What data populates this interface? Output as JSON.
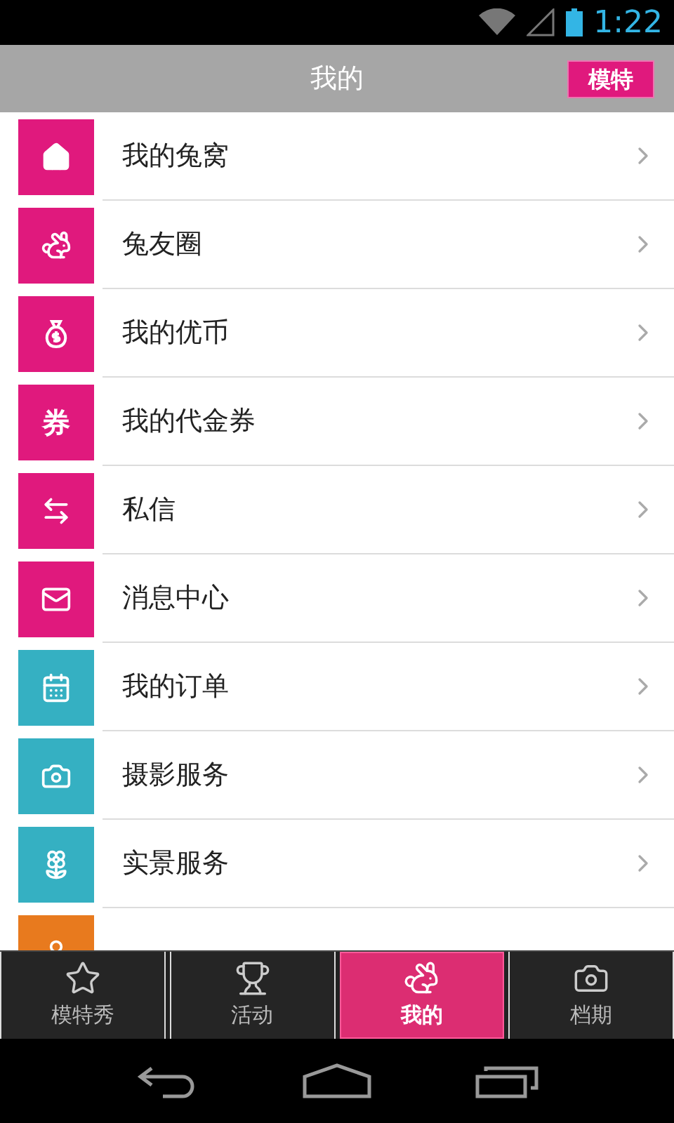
{
  "status_bar": {
    "time": "1:22"
  },
  "header": {
    "title": "我的",
    "badge": "模特"
  },
  "menu": [
    {
      "label": "我的兔窝",
      "color": "#e0197d"
    },
    {
      "label": "兔友圈",
      "color": "#e0197d"
    },
    {
      "label": "我的优币",
      "color": "#e0197d"
    },
    {
      "label": "我的代金券",
      "color": "#e0197d",
      "glyph": "券"
    },
    {
      "label": "私信",
      "color": "#e0197d"
    },
    {
      "label": "消息中心",
      "color": "#e0197d"
    },
    {
      "label": "我的订单",
      "color": "#35b0c2"
    },
    {
      "label": "摄影服务",
      "color": "#35b0c2"
    },
    {
      "label": "实景服务",
      "color": "#35b0c2"
    },
    {
      "color": "#e87a1e"
    }
  ],
  "tabs": [
    {
      "label": "模特秀",
      "selected": false
    },
    {
      "label": "活动",
      "selected": false
    },
    {
      "label": "我的",
      "selected": true
    },
    {
      "label": "档期",
      "selected": false
    }
  ]
}
